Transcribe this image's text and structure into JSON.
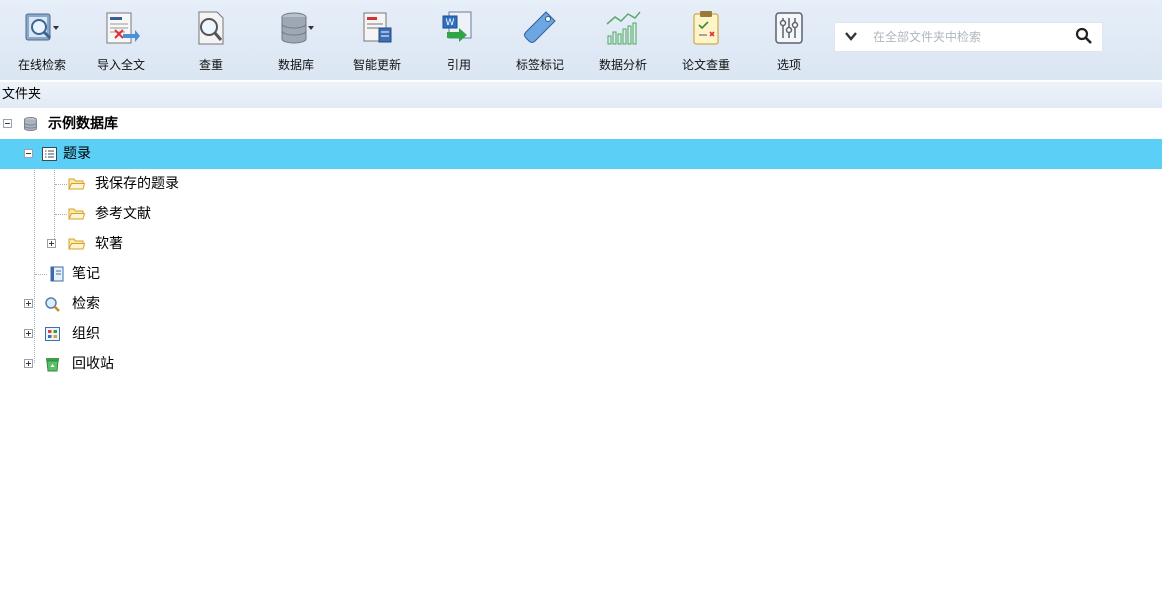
{
  "toolbar": {
    "buttons": [
      {
        "label": "在线检索",
        "icon": "online-search-icon"
      },
      {
        "label": "导入全文",
        "icon": "import-fulltext-icon"
      },
      {
        "label": "查重",
        "icon": "duplicate-check-icon"
      },
      {
        "label": "数据库",
        "icon": "database-icon"
      },
      {
        "label": "智能更新",
        "icon": "smart-update-icon"
      },
      {
        "label": "引用",
        "icon": "cite-icon"
      },
      {
        "label": "标签标记",
        "icon": "tag-icon"
      },
      {
        "label": "数据分析",
        "icon": "data-analysis-icon"
      },
      {
        "label": "论文查重",
        "icon": "paper-check-icon"
      },
      {
        "label": "选项",
        "icon": "options-icon"
      }
    ],
    "search": {
      "placeholder": "在全部文件夹中检索",
      "value": ""
    }
  },
  "folder_pane": {
    "title": "文件夹",
    "tree": [
      {
        "label": "示例数据库",
        "icon": "database-icon",
        "bold": true
      },
      {
        "label": "题录",
        "icon": "list-icon",
        "selected": true
      },
      {
        "label": "我保存的题录",
        "icon": "folder-icon"
      },
      {
        "label": "参考文献",
        "icon": "folder-icon"
      },
      {
        "label": "软著",
        "icon": "folder-icon"
      },
      {
        "label": "笔记",
        "icon": "notebook-icon"
      },
      {
        "label": "检索",
        "icon": "search-icon"
      },
      {
        "label": "组织",
        "icon": "organize-icon"
      },
      {
        "label": "回收站",
        "icon": "recycle-bin-icon"
      }
    ]
  },
  "colors": {
    "selection": "#5ccff7",
    "toolbar_bg": "#dde7f3"
  }
}
